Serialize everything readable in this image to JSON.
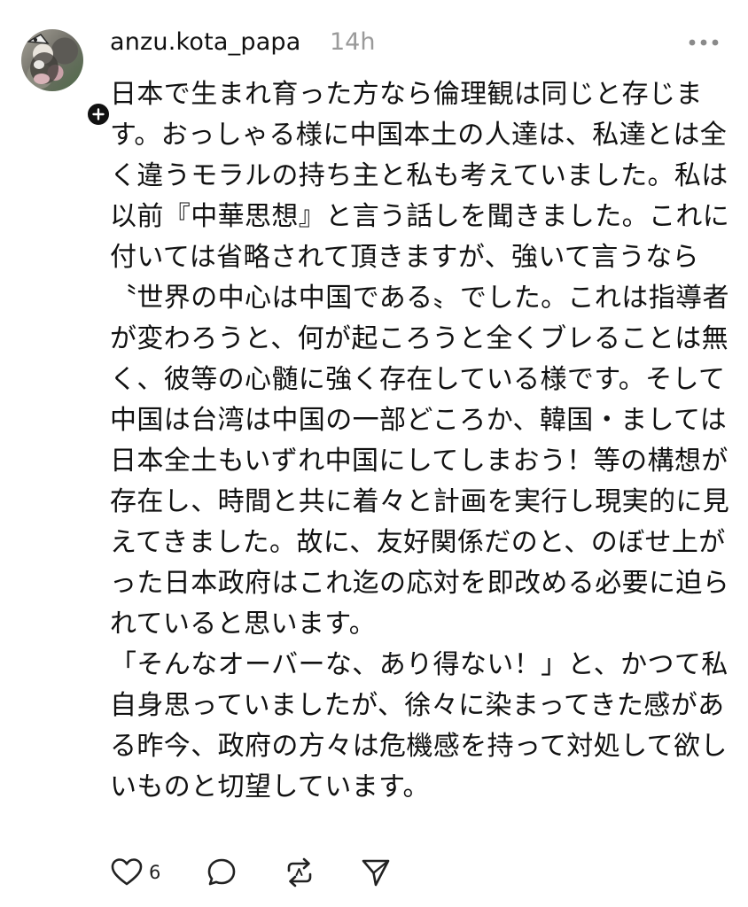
{
  "post": {
    "username": "anzu.kota_papa",
    "timestamp": "14h",
    "body": "日本で生まれ育った方なら倫理観は同じと存じます。おっしゃる様に中国本土の人達は、私達とは全く違うモラルの持ち主と私も考えていました。私は以前『中華思想』と言う話しを聞きました。これに付いては省略されて頂きますが、強いて言うなら〝世界の中心は中国である〟でした。これは指導者が変わろうと、何が起ころうと全くブレることは無く、彼等の心髄に強く存在している様です。そして中国は台湾は中国の一部どころか、韓国・ましては日本全土もいずれ中国にしてしまおう！等の構想が存在し、時間と共に着々と計画を実行し現実的に見えてきました。故に、友好関係だのと、のぼせ上がった日本政府はこれ迄の応対を即改める必要に迫られていると思います。\n「そんなオーバーな、あり得ない！」と、かつて私自身思っていましたが、徐々に染まってきた感がある昨今、政府の方々は危機感を持って対処して欲しいものと切望しています。",
    "like_count": "6"
  },
  "icons": {
    "avatar": "profile-photo-dog",
    "follow": "plus-icon",
    "more": "more-horizontal-icon",
    "like": "heart-outline-icon",
    "comment": "speech-bubble-icon",
    "repost": "repost-arrows-icon",
    "share": "paper-plane-icon"
  },
  "colors": {
    "text": "#111111",
    "muted": "#9a9a9a",
    "background": "#ffffff"
  }
}
